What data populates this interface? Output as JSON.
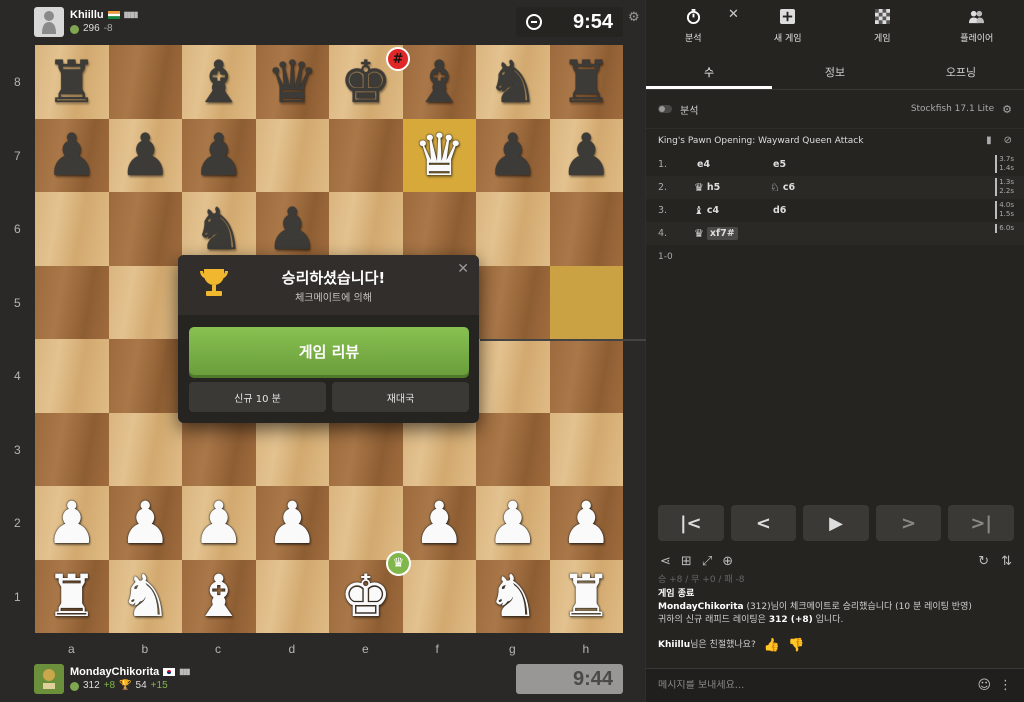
{
  "top_player": {
    "name": "Khiillu",
    "rating": "296",
    "delta": "-8",
    "bars": "▮▮▮▮"
  },
  "top_clock": "9:54",
  "bottom_player": {
    "name": "MondayChikorita",
    "rating": "312",
    "delta": "+8",
    "puzzle": "54",
    "puzzle_delta": "+15",
    "bars": "▮▮▮"
  },
  "bottom_clock": "9:44",
  "ranks": [
    "8",
    "7",
    "6",
    "5",
    "4",
    "3",
    "2",
    "1"
  ],
  "files": [
    "a",
    "b",
    "c",
    "d",
    "e",
    "f",
    "g",
    "h"
  ],
  "board": [
    [
      "br",
      "",
      "bb",
      "bq",
      "bk",
      "bb",
      "bn",
      "br"
    ],
    [
      "bp",
      "bp",
      "bp",
      "",
      "",
      "wq",
      "bp",
      "bp"
    ],
    [
      "",
      "",
      "bn",
      "bp",
      "",
      "",
      "",
      ""
    ],
    [
      "",
      "",
      "",
      "",
      "",
      "",
      "",
      ""
    ],
    [
      "",
      "",
      "",
      "",
      "",
      "",
      "",
      ""
    ],
    [
      "",
      "",
      "",
      "",
      "",
      "",
      "",
      ""
    ],
    [
      "wp",
      "wp",
      "wp",
      "wp",
      "",
      "wp",
      "wp",
      "wp"
    ],
    [
      "wr",
      "wn",
      "wb",
      "",
      "wk",
      "",
      "wn",
      "wr"
    ]
  ],
  "modal": {
    "title": "승리하셨습니다!",
    "subtitle": "체크메이트에 의해",
    "review": "게임 리뷰",
    "new_game": "신규 10 분",
    "rematch": "재대국"
  },
  "panel": {
    "tabs": [
      {
        "label": "분석",
        "icon": "stopwatch-icon"
      },
      {
        "label": "새 게임",
        "icon": "plus-icon"
      },
      {
        "label": "게임",
        "icon": "board-icon"
      },
      {
        "label": "플레이어",
        "icon": "players-icon"
      }
    ],
    "subtabs": [
      "수",
      "정보",
      "오프닝"
    ],
    "analysis_label": "분석",
    "engine": "Stockfish 17.1 Lite",
    "opening": "King's Pawn Opening: Wayward Queen Attack",
    "moves": [
      {
        "no": "1.",
        "w": "e4",
        "wfig": "",
        "b": "e5",
        "bfig": "",
        "t1": "3.7s",
        "t2": "1.4s"
      },
      {
        "no": "2.",
        "w": "h5",
        "wfig": "♛",
        "b": "c6",
        "bfig": "♘",
        "t1": "1.3s",
        "t2": "2.2s"
      },
      {
        "no": "3.",
        "w": "c4",
        "wfig": "♝",
        "b": "d6",
        "bfig": "",
        "t1": "4.0s",
        "t2": "1.5s"
      },
      {
        "no": "4.",
        "w": "xf7#",
        "wfig": "♛",
        "b": "",
        "bfig": "",
        "t1": "6.0s",
        "t2": ""
      }
    ],
    "result": "1-0",
    "chat": {
      "faded": "승 +8 / 무 +0 / 패 -8",
      "game_over": "게임 종료",
      "line1_name": "MondayChikorita",
      "line1_rest": " (312)님이 체크메이트로 승리했습니다 (10 분 레이팅 반영)",
      "line2_pre": "귀하의 신규 래피드 레이팅은 ",
      "line2_val": "312 (+8)",
      "line2_post": " 입니다.",
      "rate_name": "Khiillu",
      "rate_q": "님은 친절했나요?"
    },
    "input_placeholder": "메시지를 보내세요..."
  }
}
